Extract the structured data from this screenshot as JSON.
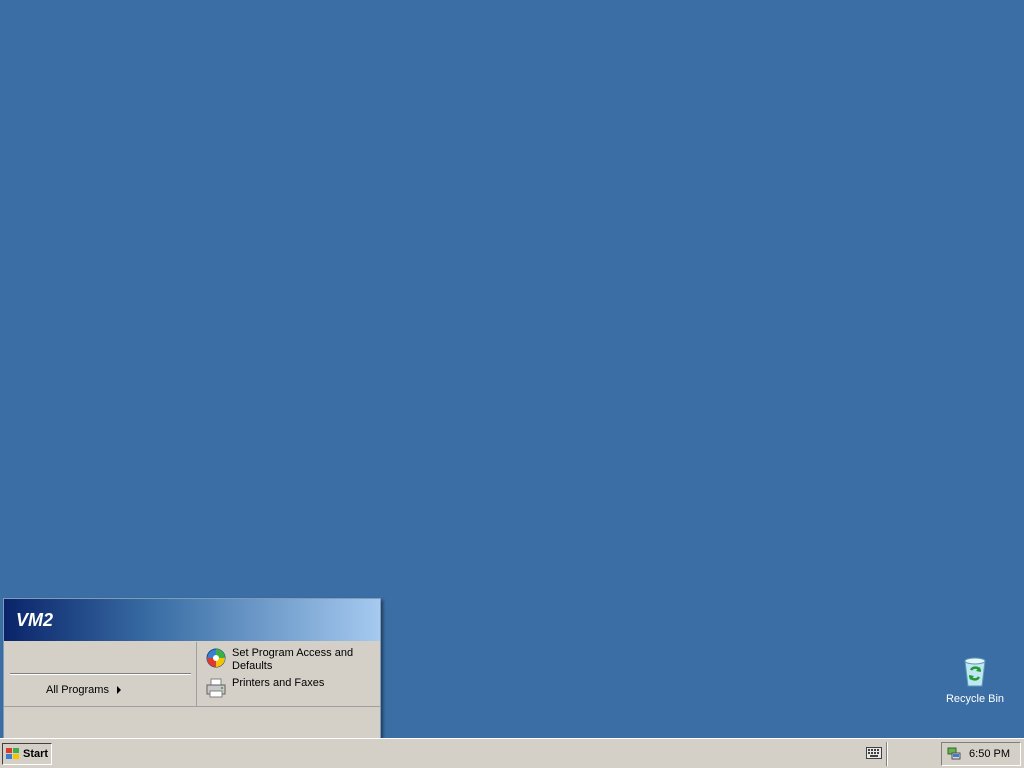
{
  "desktop": {
    "background": "#3a6ea5",
    "icons": [
      {
        "label": "Recycle Bin",
        "icon": "recycle-bin-icon"
      }
    ]
  },
  "start_menu": {
    "user_name": "VM2",
    "left_items": [
      {
        "label": "All Programs",
        "icon": "arrow-right-icon"
      }
    ],
    "right_items": [
      {
        "label": "Set Program Access and Defaults",
        "icon": "program-access-icon"
      },
      {
        "label": "Printers and Faxes",
        "icon": "printer-icon"
      }
    ]
  },
  "taskbar": {
    "start_label": "Start",
    "tray": {
      "clock": "6:50 PM",
      "icons": [
        "keyboard-icon",
        "network-icon"
      ]
    }
  }
}
